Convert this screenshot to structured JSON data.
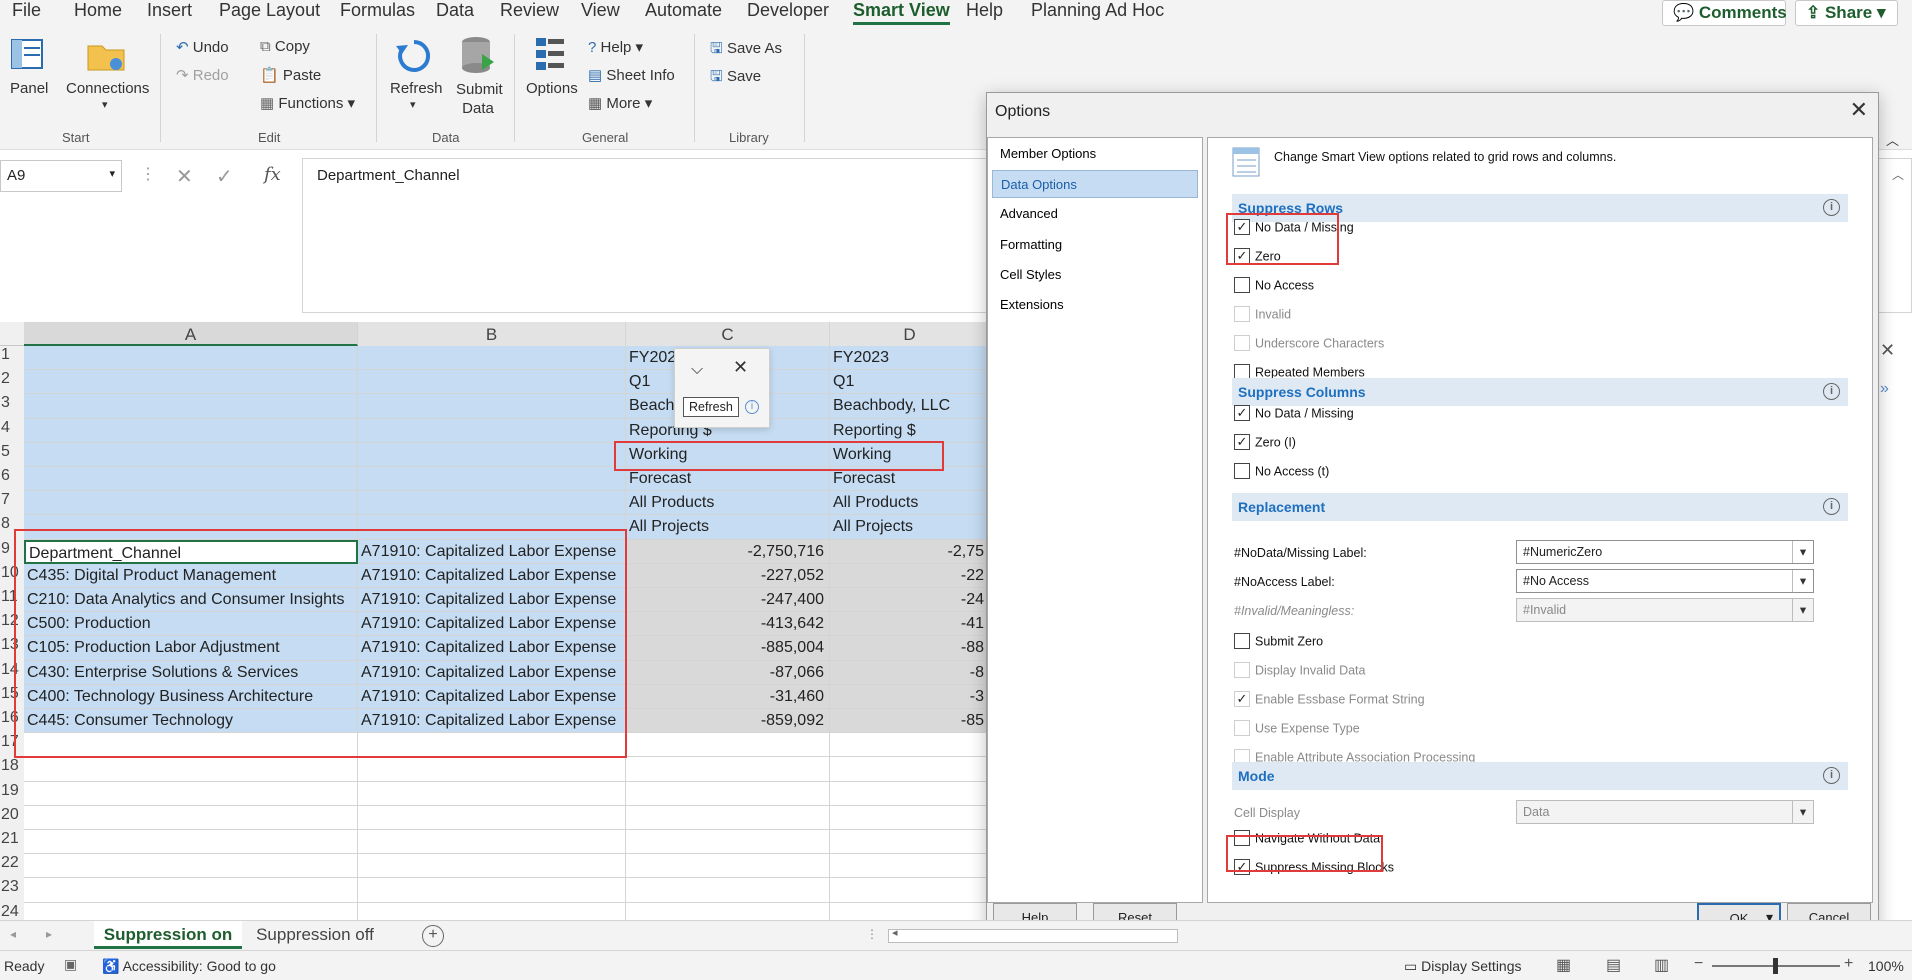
{
  "menu": {
    "items": [
      "File",
      "Home",
      "Insert",
      "Page Layout",
      "Formulas",
      "Data",
      "Review",
      "View",
      "Automate",
      "Developer",
      "Smart View",
      "Help",
      "Planning Ad Hoc"
    ],
    "active": "Smart View",
    "comments": "Comments",
    "share": "Share"
  },
  "ribbon": {
    "panel": "Panel",
    "connections": "Connections",
    "start_group": "Start",
    "undo": "Undo",
    "redo": "Redo",
    "copy": "Copy",
    "paste": "Paste",
    "functions": "Functions",
    "edit_group": "Edit",
    "refresh": "Refresh",
    "submit_data": "Submit Data",
    "data_group": "Data",
    "options": "Options",
    "help": "Help",
    "sheet_info": "Sheet Info",
    "more": "More",
    "general_group": "General",
    "save_as": "Save As",
    "save": "Save",
    "library_group": "Library"
  },
  "formula": {
    "namebox": "A9",
    "fx": "fx",
    "value": "Department_Channel"
  },
  "grid": {
    "columns": [
      "A",
      "B",
      "C",
      "D"
    ],
    "rows": [
      "1",
      "2",
      "3",
      "4",
      "5",
      "6",
      "7",
      "8",
      "9",
      "10",
      "11",
      "12",
      "13",
      "14",
      "15",
      "16",
      "17",
      "18",
      "19",
      "20",
      "21",
      "22",
      "23",
      "24"
    ],
    "header_c": [
      "FY202",
      "Q1",
      "Beach",
      "Reporting $",
      "Working",
      "Forecast",
      "All Products",
      "All Projects"
    ],
    "header_d": [
      "FY2023",
      "Q1",
      "Beachbody, LLC",
      "Reporting $",
      "Working",
      "Forecast",
      "All Products",
      "All Projects"
    ],
    "data_a": [
      "Department_Channel",
      "C435: Digital Product Management",
      "C210: Data Analytics and Consumer Insights",
      "C500: Production",
      "C105: Production Labor Adjustment",
      "C430: Enterprise Solutions & Services",
      "C400: Technology Business Architecture",
      "C445: Consumer Technology"
    ],
    "data_b": [
      "A71910: Capitalized Labor Expense",
      "A71910: Capitalized Labor Expense",
      "A71910: Capitalized Labor Expense",
      "A71910: Capitalized Labor Expense",
      "A71910: Capitalized Labor Expense",
      "A71910: Capitalized Labor Expense",
      "A71910: Capitalized Labor Expense",
      "A71910: Capitalized Labor Expense"
    ],
    "data_c": [
      "-2,750,716",
      "-227,052",
      "-247,400",
      "-413,642",
      "-885,004",
      "-87,066",
      "-31,460",
      "-859,092"
    ],
    "data_d": [
      "-2,75",
      "-22",
      "-24",
      "-41",
      "-88",
      "-8",
      "-3",
      "-85"
    ],
    "popup_refresh": "Refresh"
  },
  "dialog": {
    "title": "Options",
    "nav": [
      "Member Options",
      "Data Options",
      "Advanced",
      "Formatting",
      "Cell Styles",
      "Extensions"
    ],
    "active_nav": "Data Options",
    "description": "Change Smart View options related to grid rows and columns.",
    "suppress_rows": {
      "title": "Suppress Rows",
      "items": [
        {
          "label": "No Data / Missing",
          "checked": true
        },
        {
          "label": "Zero",
          "checked": true
        },
        {
          "label": "No Access",
          "checked": false
        },
        {
          "label": "Invalid",
          "checked": false,
          "disabled": true
        },
        {
          "label": "Underscore Characters",
          "checked": false,
          "disabled": true
        },
        {
          "label": "Repeated Members",
          "checked": false
        }
      ]
    },
    "suppress_columns": {
      "title": "Suppress Columns",
      "items": [
        {
          "label": "No Data / Missing",
          "checked": true
        },
        {
          "label": "Zero (I)",
          "checked": true
        },
        {
          "label": "No Access (t)",
          "checked": false
        }
      ]
    },
    "replacement": {
      "title": "Replacement",
      "nodata_label": "#NoData/Missing Label:",
      "nodata_value": "#NumericZero",
      "noaccess_label": "#NoAccess Label:",
      "noaccess_value": "#No Access",
      "invalid_label": "#Invalid/Meaningless:",
      "invalid_value": "#Invalid",
      "items": [
        {
          "label": "Submit Zero",
          "checked": false
        },
        {
          "label": "Display Invalid Data",
          "checked": false,
          "disabled": true
        },
        {
          "label": "Enable Essbase Format String",
          "checked": true,
          "disabled": true
        },
        {
          "label": "Use Expense Type",
          "checked": false,
          "disabled": true
        },
        {
          "label": "Enable Attribute Association Processing",
          "checked": false,
          "disabled": true
        }
      ]
    },
    "mode": {
      "title": "Mode",
      "cell_display_label": "Cell Display",
      "cell_display_value": "Data",
      "items": [
        {
          "label": "Navigate Without Data",
          "checked": false
        },
        {
          "label": "Suppress Missing Blocks",
          "checked": true
        }
      ]
    },
    "buttons": {
      "help": "Help",
      "reset": "Reset",
      "ok": "OK",
      "cancel": "Cancel"
    }
  },
  "sheets": {
    "tabs": [
      "Suppression on",
      "Suppression off"
    ],
    "active": "Suppression on"
  },
  "status": {
    "ready": "Ready",
    "accessibility": "Accessibility: Good to go",
    "display_settings": "Display Settings",
    "zoom": "100%"
  }
}
